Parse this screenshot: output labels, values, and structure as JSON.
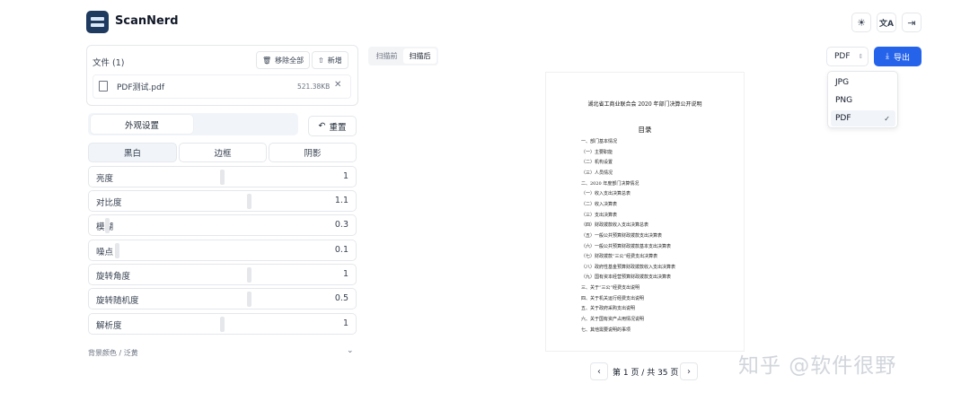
{
  "app": {
    "name": "ScanNerd"
  },
  "header": {
    "icons": [
      "sun-icon",
      "translate-icon",
      "logout-icon"
    ]
  },
  "files": {
    "title": "文件 (1)",
    "remove_all_label": "移除全部",
    "add_label": "新增",
    "items": [
      {
        "name": "PDF测试.pdf",
        "size": "521.38KB"
      }
    ]
  },
  "settings": {
    "tab_label": "外观设置",
    "reset_label": "重置",
    "subtabs": [
      "黑白",
      "边框",
      "阴影"
    ],
    "active_subtab": "黑白",
    "sliders": [
      {
        "label": "亮度",
        "value": "1",
        "level": 0.5
      },
      {
        "label": "对比度",
        "value": "1.1",
        "level": 0.6
      },
      {
        "label": "模糊",
        "value": "0.3",
        "level": 0.05
      },
      {
        "label": "噪点",
        "value": "0.1",
        "level": 0.1
      },
      {
        "label": "旋转角度",
        "value": "1",
        "level": 0.6
      },
      {
        "label": "旋转随机度",
        "value": "0.5",
        "level": 0.6
      },
      {
        "label": "解析度",
        "value": "1",
        "level": 0.5
      }
    ],
    "background_label": "背景颜色 / 泛黄"
  },
  "preview": {
    "toggle": [
      "扫描前",
      "扫描后"
    ],
    "active_toggle": "扫描后",
    "document": {
      "title": "湖北省工商业联合会 2020 年部门决算公开说明",
      "toc_heading": "目录",
      "lines": [
        "一、部门基本情况",
        "（一）主要职能",
        "（二）机构设置",
        "（三）人员情况",
        "二、2020 年度部门决算情况",
        "（一）收入支出决算总表",
        "（二）收入决算表",
        "（三）支出决算表",
        "（四）财政拨款收入支出决算总表",
        "（五）一般公共预算财政拨款支出决算表",
        "（六）一般公共预算财政拨款基本支出决算表",
        "（七）财政拨款“三公”经费支出决算表",
        "（八）政府性基金预算财政拨款收入支出决算表",
        "（九）国有资本经营预算财政拨款支出决算表",
        "三、关于“三公”经费支出说明",
        "四、关于机关运行经费支出说明",
        "五、关于政府采购支出说明",
        "六、关于国有资产占用情况说明",
        "七、其他需要说明的事项"
      ]
    },
    "pager": {
      "text": "第 1 页 / 共 35 页"
    }
  },
  "export": {
    "format_selected": "PDF",
    "export_label": "导出",
    "options": [
      "JPG",
      "PNG",
      "PDF"
    ]
  },
  "watermark": "知乎 @软件很野",
  "colors": {
    "brand": "#1e3a5f",
    "accent": "#2563eb"
  }
}
